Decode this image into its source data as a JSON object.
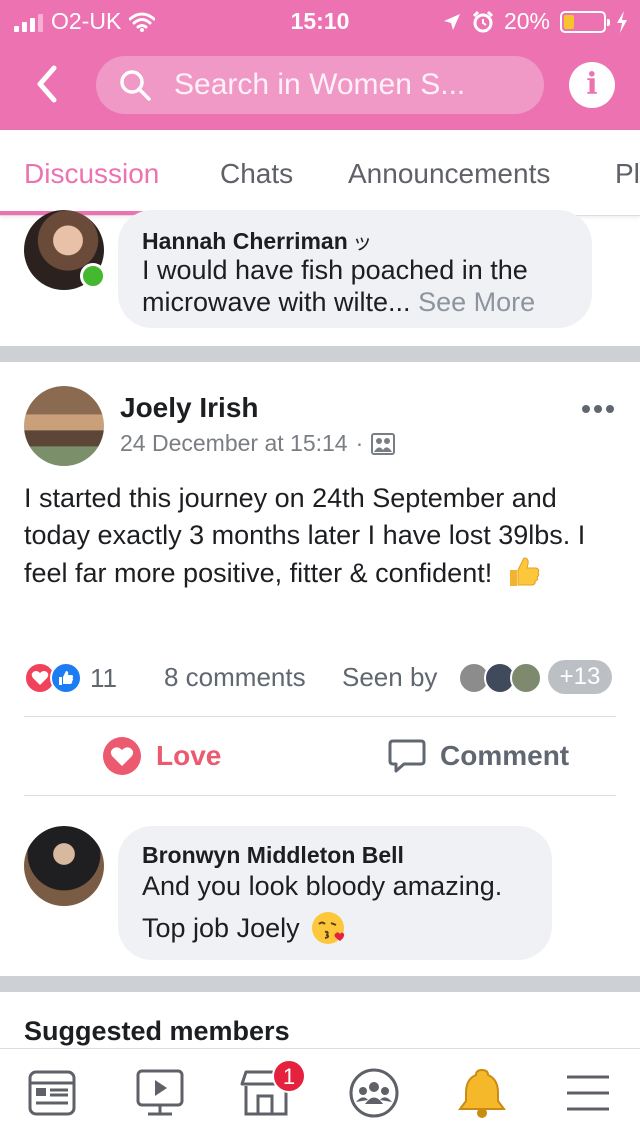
{
  "status_bar": {
    "carrier": "O2-UK",
    "time": "15:10",
    "battery": "20%",
    "battery_level": 0.2
  },
  "header": {
    "search_placeholder": "Search in Women S...",
    "info_label": "i",
    "accent_color": "#ec72b1"
  },
  "tabs": [
    {
      "label": "Discussion",
      "active": true
    },
    {
      "label": "Chats",
      "active": false
    },
    {
      "label": "Announcements",
      "active": false
    },
    {
      "label": "Pl",
      "active": false
    }
  ],
  "top_comment": {
    "author": "Hannah Cherriman",
    "author_suffix": "ッ",
    "text": "I would have fish poached in the microwave with wilte...",
    "see_more": "See More",
    "online": true
  },
  "post": {
    "author": "Joely Irish",
    "date": "24 December at 15:14",
    "privacy_dot": "·",
    "body": "I started this journey on 24th September and today exactly 3 months later I have lost 39lbs. I feel far more positive, fitter & confident!",
    "body_emoji": "thumbs-up",
    "reaction_count": "11",
    "comments": "8 comments",
    "seen_by": "Seen by",
    "seen_more": "+13",
    "love_label": "Love",
    "comment_label": "Comment"
  },
  "reply": {
    "author": "Bronwyn Middleton Bell",
    "text_line1": "And you look bloody amazing.",
    "text_line2": "Top job Joely"
  },
  "suggested": {
    "title": "Suggested members"
  },
  "bottom_nav": {
    "items": [
      "news-feed-icon",
      "watch-icon",
      "marketplace-icon",
      "groups-icon",
      "notifications-icon",
      "menu-icon"
    ],
    "marketplace_badge": "1"
  }
}
